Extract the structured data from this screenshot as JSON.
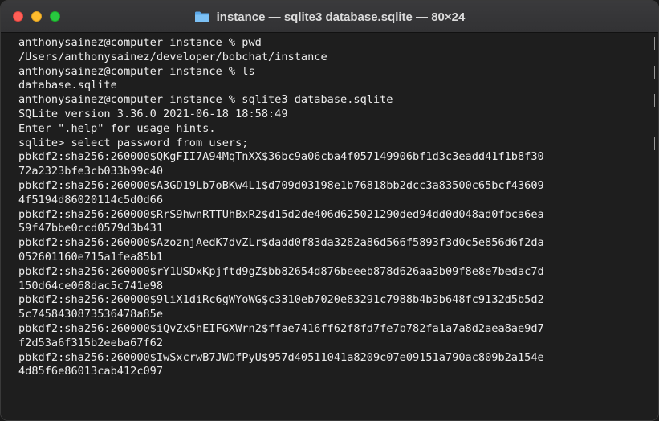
{
  "window": {
    "title": "instance — sqlite3 database.sqlite — 80×24",
    "folder_icon": "folder-icon",
    "traffic_lights": {
      "close": "#ff5f57",
      "minimize": "#febc2e",
      "maximize": "#28c840"
    }
  },
  "terminal": {
    "lines": [
      {
        "text": "anthonysainez@computer instance % pwd",
        "marked": true
      },
      {
        "text": "/Users/anthonysainez/developer/bobchat/instance",
        "marked": false
      },
      {
        "text": "anthonysainez@computer instance % ls",
        "marked": true
      },
      {
        "text": "database.sqlite",
        "marked": false
      },
      {
        "text": "anthonysainez@computer instance % sqlite3 database.sqlite",
        "marked": true
      },
      {
        "text": "SQLite version 3.36.0 2021-06-18 18:58:49",
        "marked": false
      },
      {
        "text": "Enter \".help\" for usage hints.",
        "marked": false
      },
      {
        "text": "sqlite> select password from users;",
        "marked": true
      },
      {
        "text": "pbkdf2:sha256:260000$QKgFII7A94MqTnXX$36bc9a06cba4f057149906bf1d3c3eadd41f1b8f30",
        "marked": false
      },
      {
        "text": "72a2323bfe3cb033b99c40",
        "marked": false
      },
      {
        "text": "pbkdf2:sha256:260000$A3GD19Lb7oBKw4L1$d709d03198e1b76818bb2dcc3a83500c65bcf43609",
        "marked": false
      },
      {
        "text": "4f5194d86020114c5d0d66",
        "marked": false
      },
      {
        "text": "pbkdf2:sha256:260000$RrS9hwnRTTUhBxR2$d15d2de406d625021290ded94dd0d048ad0fbca6ea",
        "marked": false
      },
      {
        "text": "59f47bbe0ccd0579d3b431",
        "marked": false
      },
      {
        "text": "pbkdf2:sha256:260000$AzoznjAedK7dvZLr$dadd0f83da3282a86d566f5893f3d0c5e856d6f2da",
        "marked": false
      },
      {
        "text": "052601160e715a1fea85b1",
        "marked": false
      },
      {
        "text": "pbkdf2:sha256:260000$rY1USDxKpjftd9gZ$bb82654d876beeeb878d626aa3b09f8e8e7bedac7d",
        "marked": false
      },
      {
        "text": "150d64ce068dac5c741e98",
        "marked": false
      },
      {
        "text": "pbkdf2:sha256:260000$9liX1diRc6gWYoWG$c3310eb7020e83291c7988b4b3b648fc9132d5b5d2",
        "marked": false
      },
      {
        "text": "5c7458430873536478a85e",
        "marked": false
      },
      {
        "text": "pbkdf2:sha256:260000$iQvZx5hEIFGXWrn2$ffae7416ff62f8fd7fe7b782fa1a7a8d2aea8ae9d7",
        "marked": false
      },
      {
        "text": "f2d53a6f315b2eeba67f62",
        "marked": false
      },
      {
        "text": "pbkdf2:sha256:260000$IwSxcrwB7JWDfPyU$957d40511041a8209c07e09151a790ac809b2a154e",
        "marked": false
      },
      {
        "text": "4d85f6e86013cab412c097",
        "marked": false
      }
    ]
  }
}
